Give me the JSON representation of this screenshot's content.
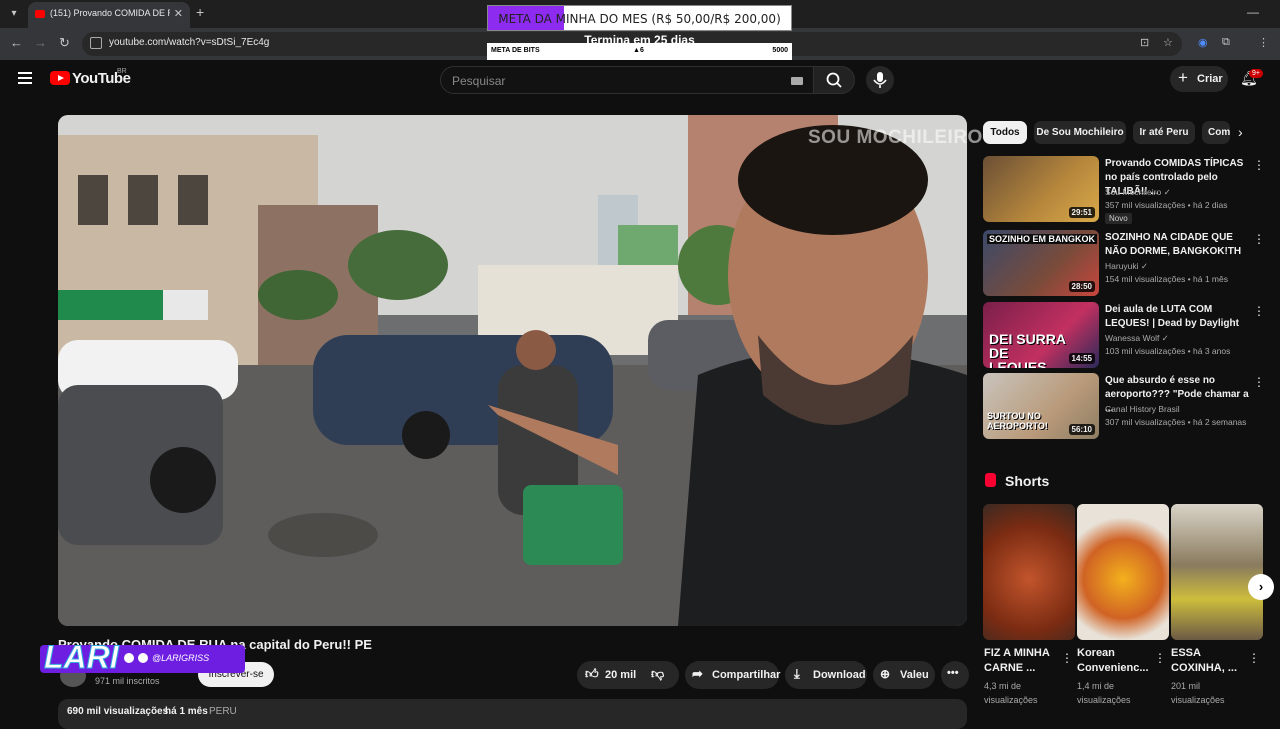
{
  "browser": {
    "tab_title": "(151) Provando COMIDA DE RUA",
    "url": "youtube.com/watch?v=sDtSi_7Ec4g"
  },
  "overlay": {
    "goal_text": "META DA MINHA DO MES (R$ 50,00/R$ 200,00)",
    "goal_fraction": 0.25,
    "goal_sub": "Termina em 25 dias",
    "bits_label": "META DE BITS",
    "bits_current": "6",
    "bits_target": "5000",
    "streamer_name": "LARI",
    "streamer_handle": "@LARIGRISS"
  },
  "header": {
    "logo_text": "YouTube",
    "country": "BR",
    "search_placeholder": "Pesquisar",
    "create_label": "Criar",
    "notif_count": "9+"
  },
  "video": {
    "watermark": "SOU MOCHILEIRO",
    "title": "Provando COMIDA DE RUA na capital do Peru!! PE",
    "subscribers": "971 mil inscritos",
    "subscribe_label": "Inscrever-se",
    "likes": "20 mil",
    "share_label": "Compartilhar",
    "download_label": "Download",
    "thanks_label": "Valeu",
    "views": "690 mil visualizações",
    "age": "há 1 mês",
    "location": "PERU"
  },
  "chips": [
    "Todos",
    "De Sou Mochileiro",
    "Ir até Peru",
    "Com"
  ],
  "recommendations": [
    {
      "title": "Provando COMIDAS TÍPICAS no país controlado pelo TALIBÃ!! ...",
      "channel": "Sou Mochileiro ✓",
      "meta": "357 mil visualizações • há 2 dias",
      "duration": "29:51",
      "badge": "Novo"
    },
    {
      "title": "SOZINHO NA CIDADE QUE NÃO DORME, BANGKOK!TH",
      "channel": "Haruyuki ✓",
      "meta": "154 mil visualizações • há 1 mês",
      "duration": "28:50",
      "thumb_text": "SOZINHO EM BANGKOK"
    },
    {
      "title": "Dei aula de LUTA COM LEQUES! | Dead by Daylight",
      "channel": "Wanessa Wolf ✓",
      "meta": "103 mil visualizações • há 3 anos",
      "duration": "14:55",
      "thumb_text": "DEI SURRA DE LEQUES"
    },
    {
      "title": "Que absurdo é esse no aeroporto??? \"Pode chamar a ...",
      "channel": "Canal History Brasil",
      "meta": "307 mil visualizações • há 2 semanas",
      "duration": "56:10",
      "thumb_text": "SURTOU NO AEROPORTO!"
    }
  ],
  "shorts": {
    "heading": "Shorts",
    "items": [
      {
        "title": "FIZ A MINHA CARNE ...",
        "views": "4,3 mi de visualizações"
      },
      {
        "title": "Korean Convenienc...",
        "views": "1,4 mi de visualizações"
      },
      {
        "title": "ESSA COXINHA, ...",
        "views": "201 mil visualizações"
      }
    ]
  }
}
